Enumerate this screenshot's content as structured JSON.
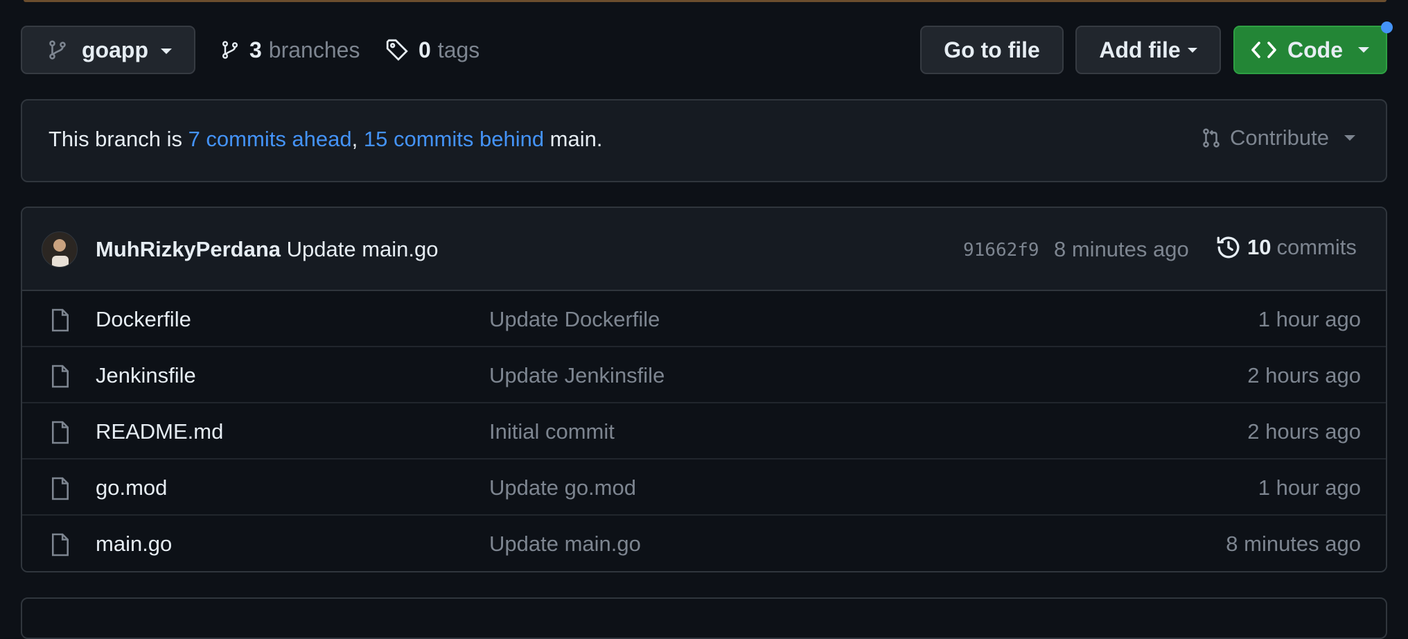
{
  "toolbar": {
    "branch_name": "goapp",
    "branches_count": "3",
    "branches_label": "branches",
    "tags_count": "0",
    "tags_label": "tags",
    "go_to_file_label": "Go to file",
    "add_file_label": "Add file",
    "code_label": "Code"
  },
  "branch_status": {
    "prefix": "This branch is ",
    "ahead_text": "7 commits ahead",
    "separator": ", ",
    "behind_text": "15 commits behind",
    "suffix": " main.",
    "contribute_label": "Contribute"
  },
  "latest_commit": {
    "author": "MuhRizkyPerdana",
    "message": "Update main.go",
    "sha": "91662f9",
    "time": "8 minutes ago",
    "commits_count": "10",
    "commits_label": "commits"
  },
  "files": [
    {
      "name": "Dockerfile",
      "message": "Update Dockerfile",
      "time": "1 hour ago"
    },
    {
      "name": "Jenkinsfile",
      "message": "Update Jenkinsfile",
      "time": "2 hours ago"
    },
    {
      "name": "README.md",
      "message": "Initial commit",
      "time": "2 hours ago"
    },
    {
      "name": "go.mod",
      "message": "Update go.mod",
      "time": "1 hour ago"
    },
    {
      "name": "main.go",
      "message": "Update main.go",
      "time": "8 minutes ago"
    }
  ],
  "colors": {
    "background": "#0d1117",
    "accent_link": "#4493f8",
    "code_button": "#238636"
  }
}
